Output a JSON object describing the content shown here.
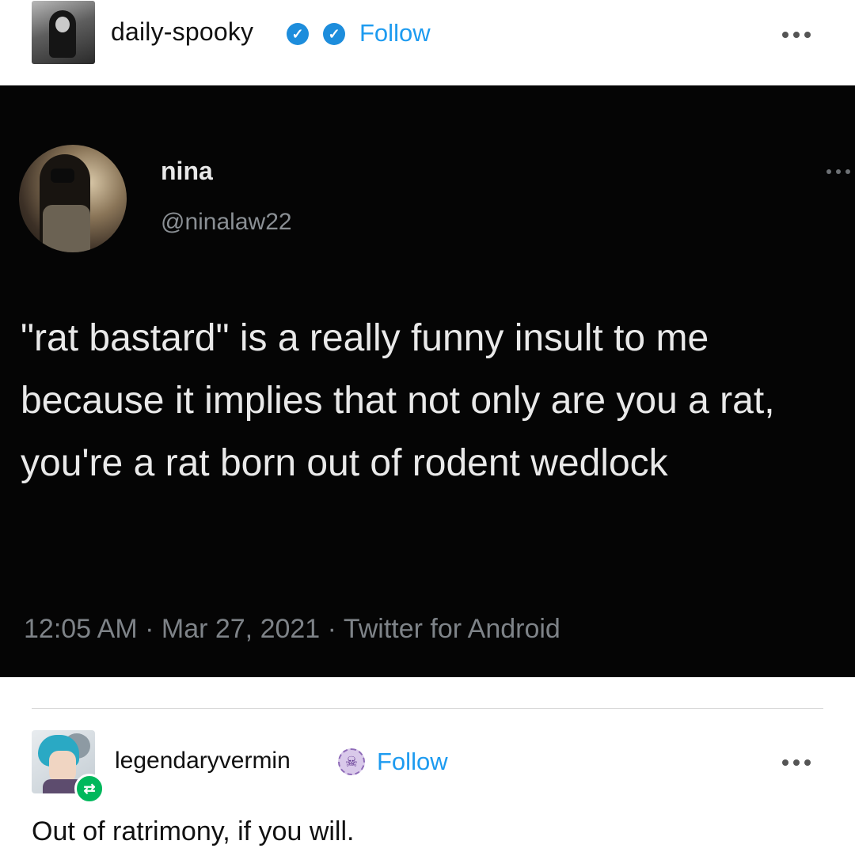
{
  "post": {
    "username": "daily-spooky",
    "follow_label": "Follow"
  },
  "tweet": {
    "name": "nina",
    "handle": "@ninalaw22",
    "text": "\"rat bastard\" is a really funny insult to me because it implies that not only are you a rat, you're a rat born out of rodent wedlock",
    "meta": "12:05 AM · Mar 27, 2021 · Twitter for Android"
  },
  "reply": {
    "username": "legendaryvermin",
    "follow_label": "Follow",
    "text": "Out of ratrimony, if you will."
  },
  "icons": {
    "verified": "verified-check-icon",
    "more": "ellipsis-icon",
    "reblog": "reblog-icon",
    "skull_badge": "skull-badge-icon"
  },
  "colors": {
    "follow": "#1d9bf0",
    "verified": "#1d8ddc",
    "reblog": "#00b85c",
    "tweet_bg": "#050505"
  }
}
